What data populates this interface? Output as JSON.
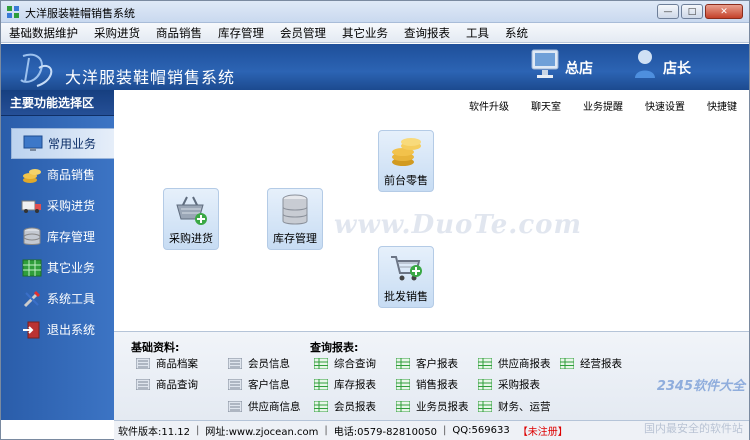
{
  "window": {
    "title": "大洋服装鞋帽销售系统",
    "buttons": [
      "—",
      "□",
      "✕"
    ]
  },
  "menu": [
    "基础数据维护",
    "采购进货",
    "商品销售",
    "库存管理",
    "会员管理",
    "其它业务",
    "查询报表",
    "工具",
    "系统"
  ],
  "banner": {
    "title": "大洋服装鞋帽销售系统",
    "store": "总店",
    "user": "店长"
  },
  "sidebar": {
    "title": "主要功能选择区",
    "items": [
      {
        "label": "常用业务",
        "icon": "monitor-icon"
      },
      {
        "label": "商品销售",
        "icon": "coins-icon"
      },
      {
        "label": "采购进货",
        "icon": "truck-icon"
      },
      {
        "label": "库存管理",
        "icon": "database-icon"
      },
      {
        "label": "其它业务",
        "icon": "grid-icon"
      },
      {
        "label": "系统工具",
        "icon": "tools-icon"
      },
      {
        "label": "退出系统",
        "icon": "exit-icon"
      }
    ]
  },
  "quicklinks": [
    "软件升级",
    "聊天室",
    "业务提醒",
    "快速设置",
    "快捷键"
  ],
  "tiles": {
    "retail": "前台零售",
    "purchase": "采购进货",
    "inventory": "库存管理",
    "wholesale": "批发销售"
  },
  "watermark": "www.DuoTe.com",
  "basic": {
    "title": "基础资料:",
    "col1": [
      "商品档案",
      "商品查询"
    ],
    "col2": [
      "会员信息",
      "客户信息",
      "供应商信息"
    ]
  },
  "reports": {
    "title": "查询报表:",
    "col1": [
      "综合查询",
      "库存报表",
      "会员报表"
    ],
    "col2": [
      "客户报表",
      "销售报表",
      "业务员报表"
    ],
    "col3": [
      "供应商报表",
      "采购报表",
      "财务、运营"
    ],
    "col4": [
      "经营报表"
    ]
  },
  "status": {
    "version": "软件版本:11.12",
    "site": "网址:www.zjocean.com",
    "phone": "电话:0579-82810050",
    "qq": "QQ:569633",
    "reg": "【未注册】"
  },
  "brand": {
    "name": "2345软件大全",
    "sub": "国内最安全的软件站"
  }
}
